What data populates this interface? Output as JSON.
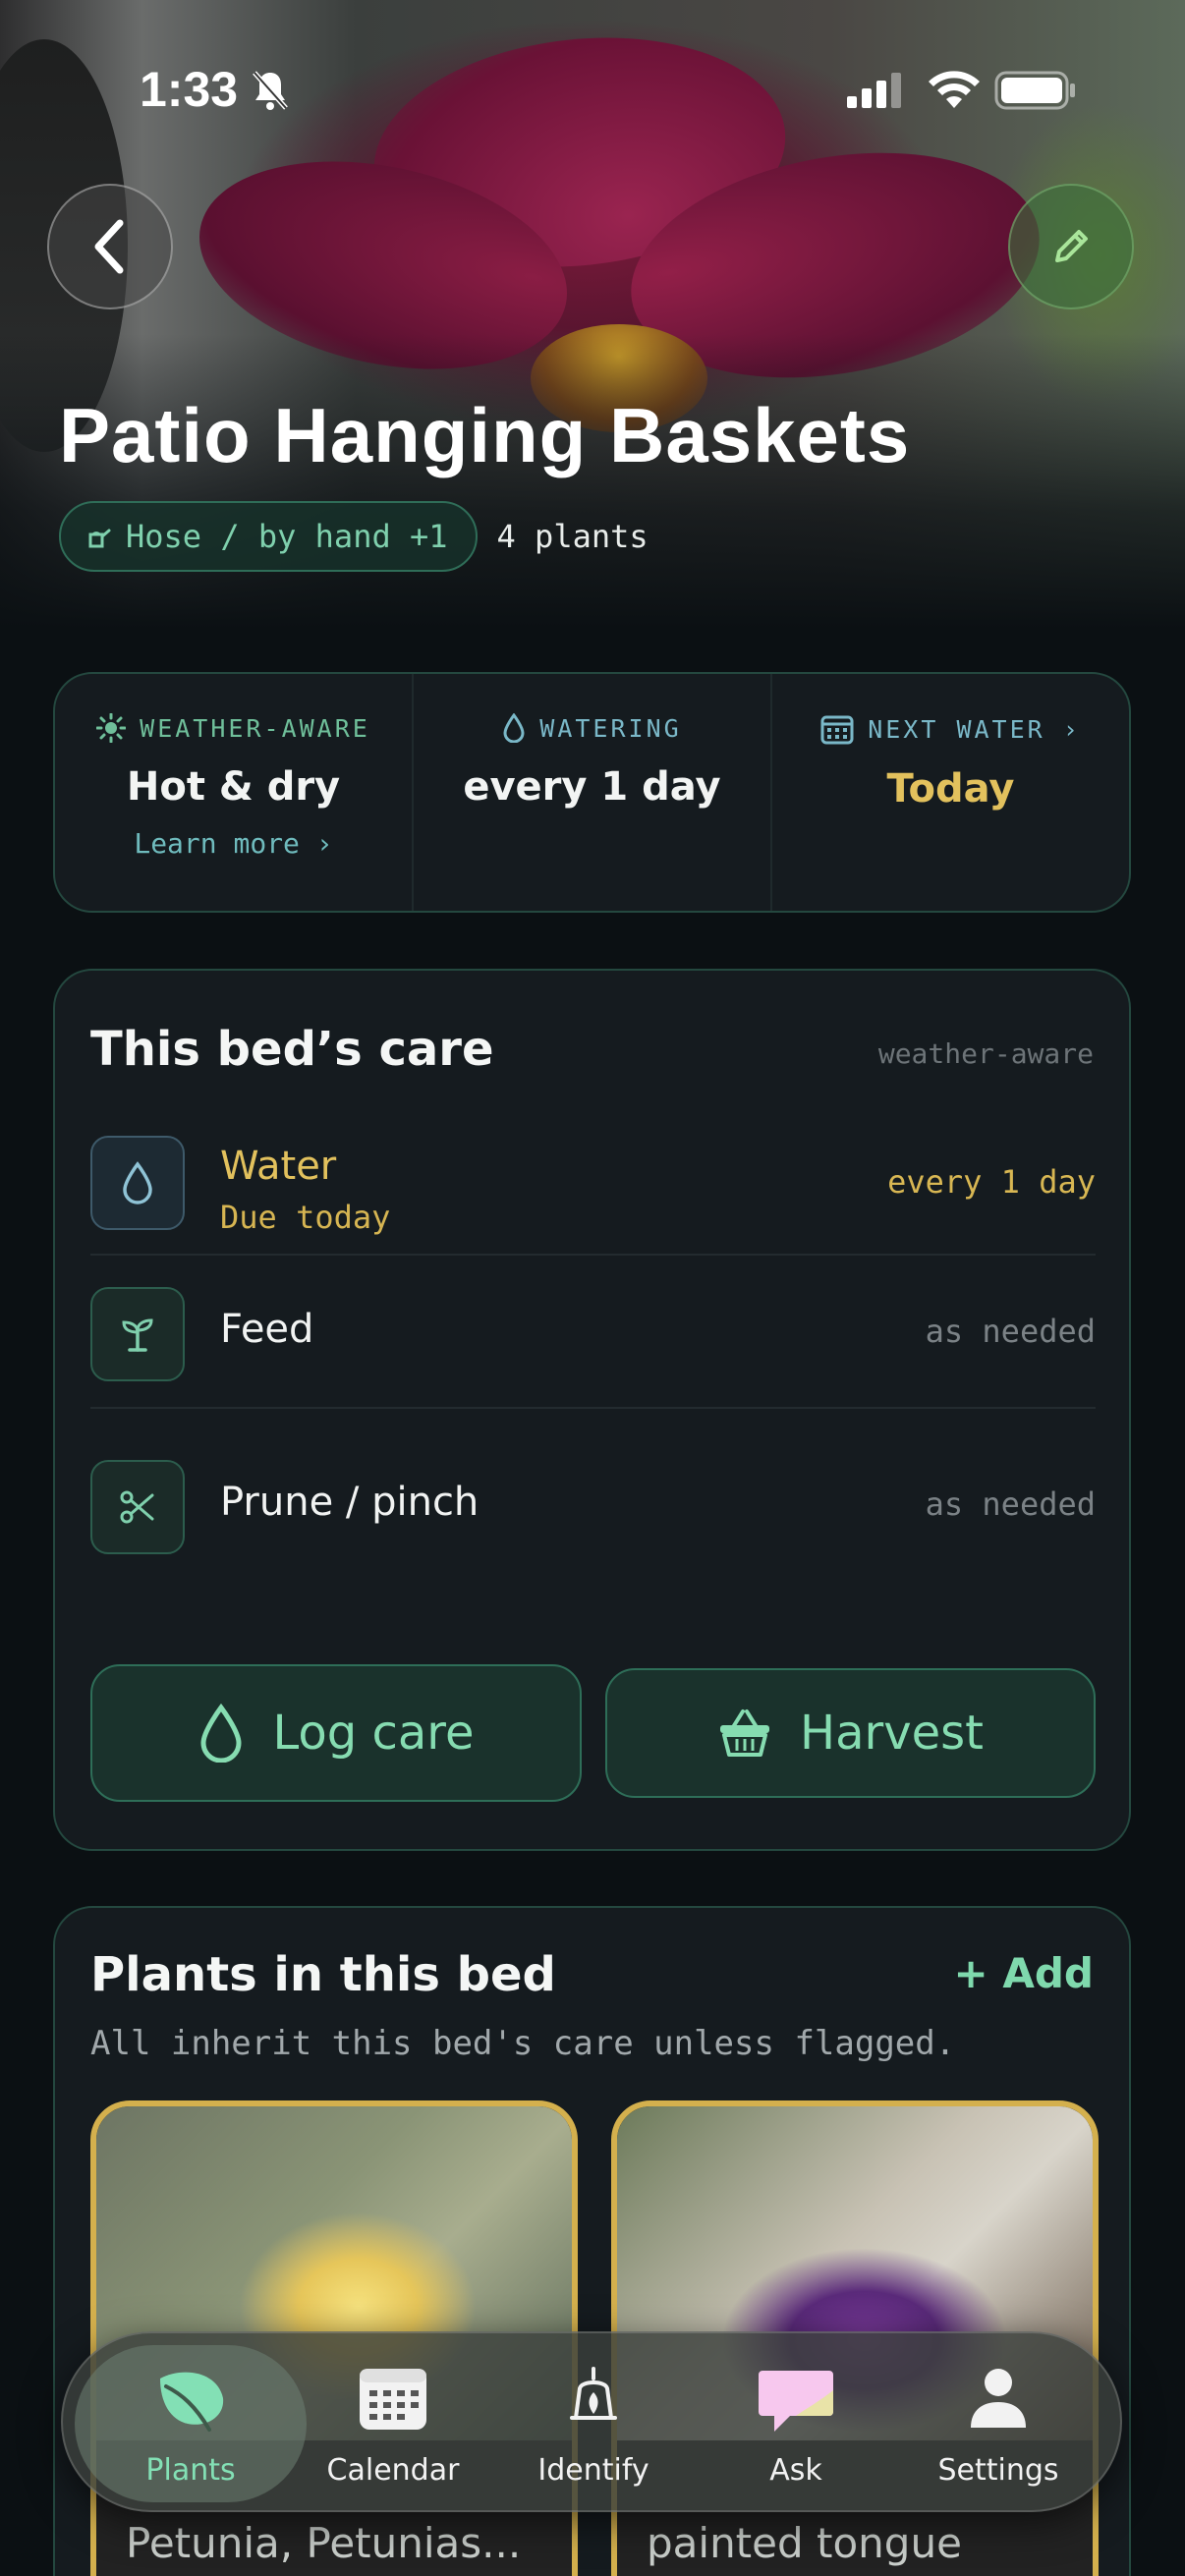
{
  "status_bar": {
    "time": "1:33"
  },
  "header": {
    "title": "Patio Hanging Baskets",
    "method_pill": "Hose / by hand +1",
    "plant_count": "4 plants"
  },
  "stats": {
    "weather": {
      "label": "WEATHER-AWARE",
      "value": "Hot & dry",
      "link": "Learn more ›"
    },
    "watering": {
      "label": "WATERING",
      "value": "every 1 day"
    },
    "next_water": {
      "label": "NEXT WATER ›",
      "value": "Today"
    }
  },
  "care": {
    "title": "This bed’s care",
    "tag": "weather-aware",
    "rows": [
      {
        "name": "Water",
        "sub": "Due today",
        "freq": "every 1 day",
        "icon": "droplet-icon"
      },
      {
        "name": "Feed",
        "freq": "as needed",
        "icon": "sprout-icon"
      },
      {
        "name": "Prune / pinch",
        "freq": "as needed",
        "icon": "scissors-icon"
      }
    ],
    "log_button": "Log care",
    "harvest_button": "Harvest"
  },
  "plants": {
    "title": "Plants in this bed",
    "add": "+ Add",
    "note": "All inherit this bed's care unless flagged.",
    "items": [
      {
        "name": "Petunia, Petunias..."
      },
      {
        "name": "painted tongue"
      }
    ]
  },
  "tabs": [
    {
      "label": "Plants",
      "icon": "leaf-icon"
    },
    {
      "label": "Calendar",
      "icon": "calendar-icon"
    },
    {
      "label": "Identify",
      "icon": "identify-icon"
    },
    {
      "label": "Ask",
      "icon": "chat-icon"
    },
    {
      "label": "Settings",
      "icon": "person-icon"
    }
  ],
  "colors": {
    "accent": "#7fd9ad",
    "gold": "#e2c15d",
    "background": "#0b1013"
  }
}
